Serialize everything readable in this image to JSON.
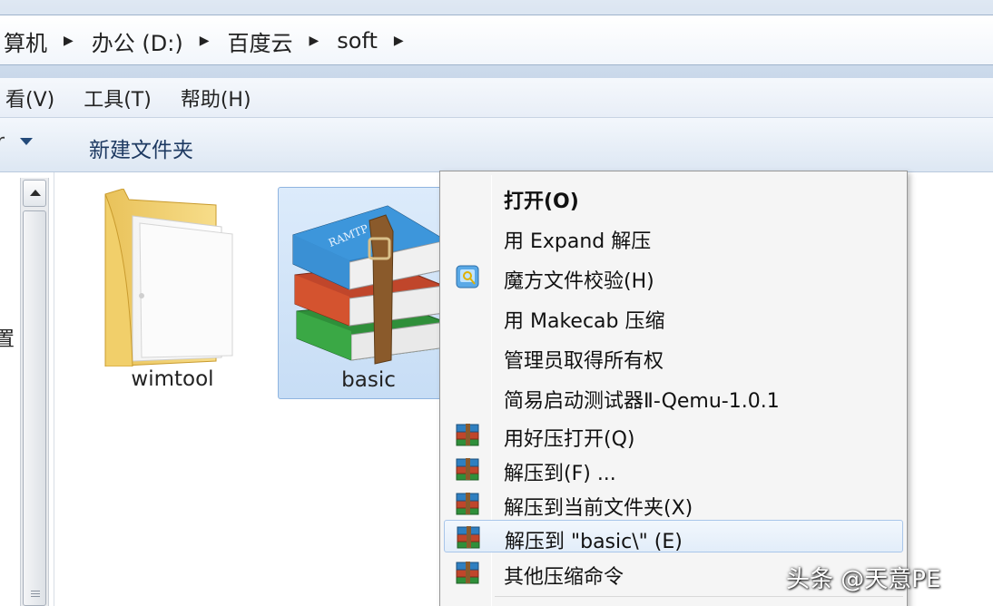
{
  "breadcrumb": {
    "items": [
      "算机",
      "办公 (D:)",
      "百度云",
      "soft"
    ]
  },
  "menubar": {
    "items": [
      "查看(V)",
      "工具(T)",
      "帮助(H)"
    ],
    "first_visible": "看(V)"
  },
  "toolbar": {
    "new_folder": "新建文件夹"
  },
  "left_pane": {
    "fragment": "置"
  },
  "files": [
    {
      "name": "wimtool",
      "icon": "folder-icon",
      "selected": false
    },
    {
      "name": "basic",
      "icon": "winrar-archive-icon",
      "selected": true
    }
  ],
  "context_menu": {
    "items": [
      {
        "label": "打开(O)",
        "bold": true,
        "icon": ""
      },
      {
        "label": "用 Expand 解压",
        "icon": ""
      },
      {
        "label": "魔方文件校验(H)",
        "icon": "file-verify-icon"
      },
      {
        "label": "用 Makecab 压缩",
        "icon": ""
      },
      {
        "label": "管理员取得所有权",
        "icon": ""
      },
      {
        "label": "简易启动测试器Ⅱ-Qemu-1.0.1",
        "icon": ""
      },
      {
        "label": "用好压打开(Q)",
        "icon": "winrar-icon"
      },
      {
        "label": "解压到(F) ...",
        "icon": "winrar-icon"
      },
      {
        "label": "解压到当前文件夹(X)",
        "icon": "winrar-icon"
      },
      {
        "label": "解压到 \"basic\\\" (E)",
        "icon": "winrar-icon",
        "hover": true
      },
      {
        "label": "其他压缩命令",
        "icon": "winrar-icon"
      }
    ]
  },
  "watermark": "头条 @天意PE",
  "colors": {
    "selection": "#cce0f7",
    "toolbar_text": "#1e3a62",
    "menu_bg": "#f5f5f5"
  }
}
